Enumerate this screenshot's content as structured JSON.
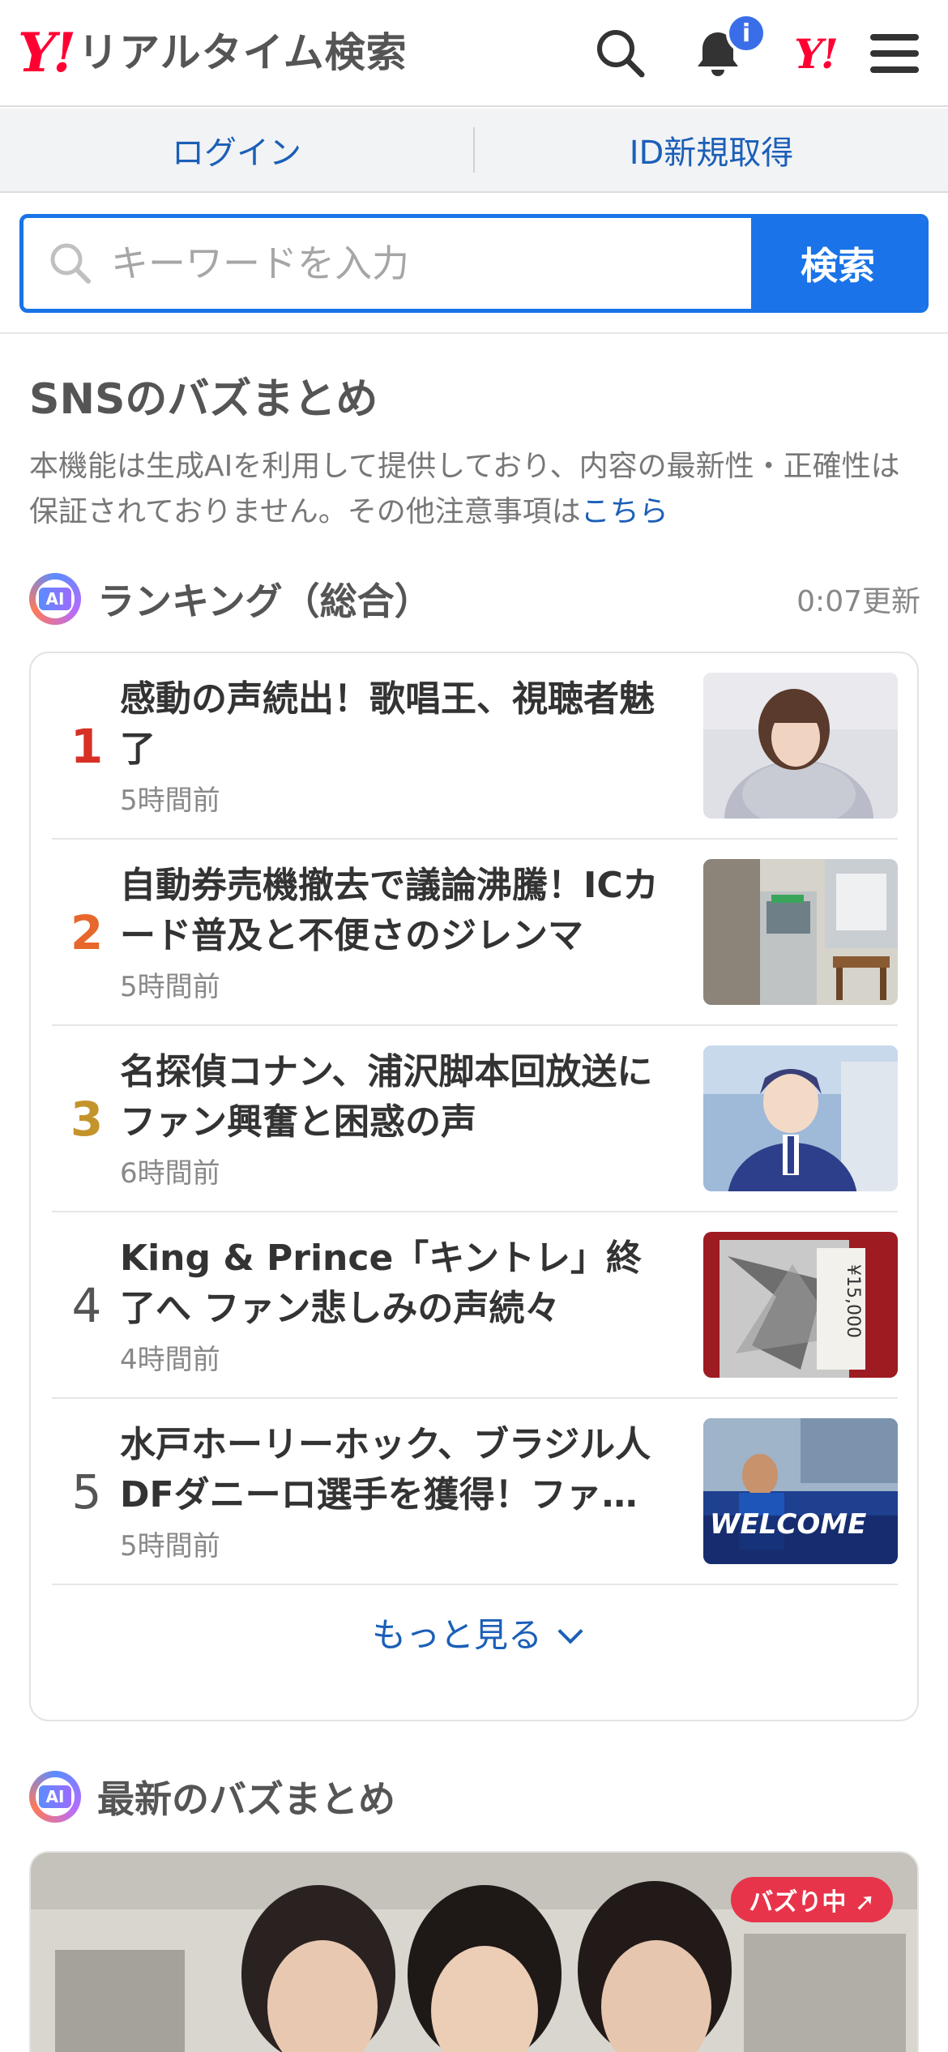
{
  "header": {
    "logo_mark": "Y!",
    "title": "リアルタイム検索",
    "notification_badge": "i",
    "yj_mark": "Y!"
  },
  "account": {
    "login": "ログイン",
    "register": "ID新規取得"
  },
  "search": {
    "placeholder": "キーワードを入力",
    "button": "検索"
  },
  "sns": {
    "title": "SNSのバズまとめ",
    "notice": "本機能は生成AIを利用して提供しており、内容の最新性・正確性は保証されておりません。その他注意事項は",
    "notice_link": "こちら"
  },
  "ranking": {
    "ai_label": "AI",
    "title": "ランキング（総合）",
    "updated": "0:07更新",
    "items": [
      {
        "rank": "1",
        "title": "感動の声続出！歌唱王、視聴者魅了",
        "time": "5時間前"
      },
      {
        "rank": "2",
        "title": "自動券売機撤去で議論沸騰！ICカード普及と不便さのジレンマ",
        "time": "5時間前"
      },
      {
        "rank": "3",
        "title": "名探偵コナン、浦沢脚本回放送にファン興奮と困惑の声",
        "time": "6時間前"
      },
      {
        "rank": "4",
        "title": "King & Prince「キントレ」終了へ ファン悲しみの声続々",
        "time": "4時間前"
      },
      {
        "rank": "5",
        "title": "水戸ホーリーホック、ブラジル人DFダニーロ選手を獲得！ファ…",
        "time": "5時間前"
      }
    ],
    "more": "もっと見る",
    "thumb_text_5": "WELCOME",
    "thumb_text_4": "¥15,000"
  },
  "latest": {
    "ai_label": "AI",
    "title": "最新のバズまとめ",
    "badge": "バズり中"
  },
  "colors": {
    "accent": "#1a73e8",
    "brand": "#ff0033",
    "link": "#1b5fb8"
  }
}
